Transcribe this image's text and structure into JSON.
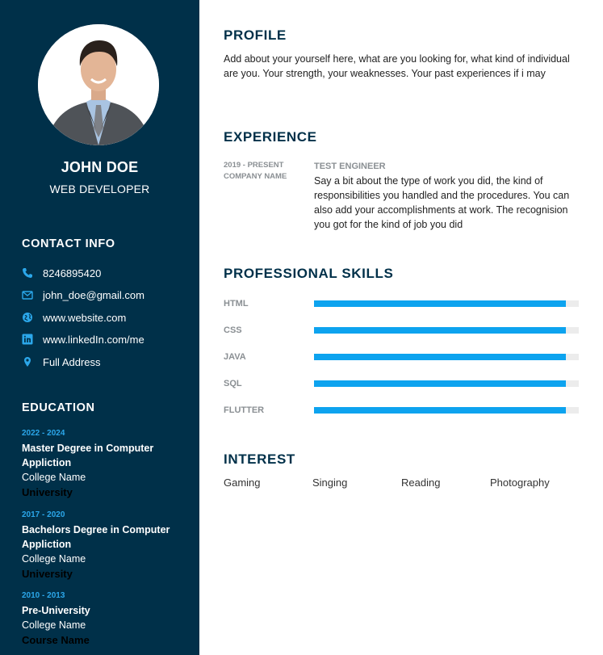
{
  "colors": {
    "sidebar_bg": "#003049",
    "accent": "#0da3ef",
    "heading": "#003049",
    "muted": "#8a8f93",
    "edu_years": "#2ba7ea"
  },
  "sidebar": {
    "name": "JOHN DOE",
    "role": "WEB DEVELOPER",
    "contact": {
      "heading": "CONTACT INFO",
      "items": [
        {
          "icon": "phone-icon",
          "text": "8246895420"
        },
        {
          "icon": "mail-icon",
          "text": "john_doe@gmail.com"
        },
        {
          "icon": "globe-icon",
          "text": "www.website.com"
        },
        {
          "icon": "linkedin-icon",
          "text": "www.linkedIn.com/me"
        },
        {
          "icon": "location-pin-icon",
          "text": "Full Address"
        }
      ]
    },
    "education": {
      "heading": "EDUCATION",
      "items": [
        {
          "years": "2022 - 2024",
          "degree": "Master Degree in Computer Appliction",
          "college": "College Name",
          "institution": "University"
        },
        {
          "years": "2017 - 2020",
          "degree": "Bachelors Degree in Computer Appliction",
          "college": "College Name",
          "institution": "University"
        },
        {
          "years": "2010 - 2013",
          "degree": "Pre-University",
          "college": "College Name",
          "institution": "Course Name"
        }
      ]
    }
  },
  "main": {
    "profile": {
      "heading": "PROFILE",
      "text": "Add about your yourself here, what are you looking for, what kind of individual are you. Your strength, your weaknesses. Your past experiences if i may"
    },
    "experience": {
      "heading": "EXPERIENCE",
      "period": "2019 - PRESENT",
      "company": "COMPANY NAME",
      "title": "TEST ENGINEER",
      "description": "Say a bit about the type of work you did, the kind of responsibilities you handled and the procedures. You can also add your accomplishments at work. The recognision you got for the kind of job you did"
    },
    "skills": {
      "heading": "PROFESSIONAL SKILLS",
      "items": [
        {
          "name": "HTML",
          "level": 0.95
        },
        {
          "name": "CSS",
          "level": 0.95
        },
        {
          "name": "JAVA",
          "level": 0.95
        },
        {
          "name": "SQL",
          "level": 0.95
        },
        {
          "name": "FLUTTER",
          "level": 0.95
        }
      ]
    },
    "interest": {
      "heading": "INTEREST",
      "items": [
        "Gaming",
        "Singing",
        "Reading",
        "Photography"
      ]
    }
  }
}
